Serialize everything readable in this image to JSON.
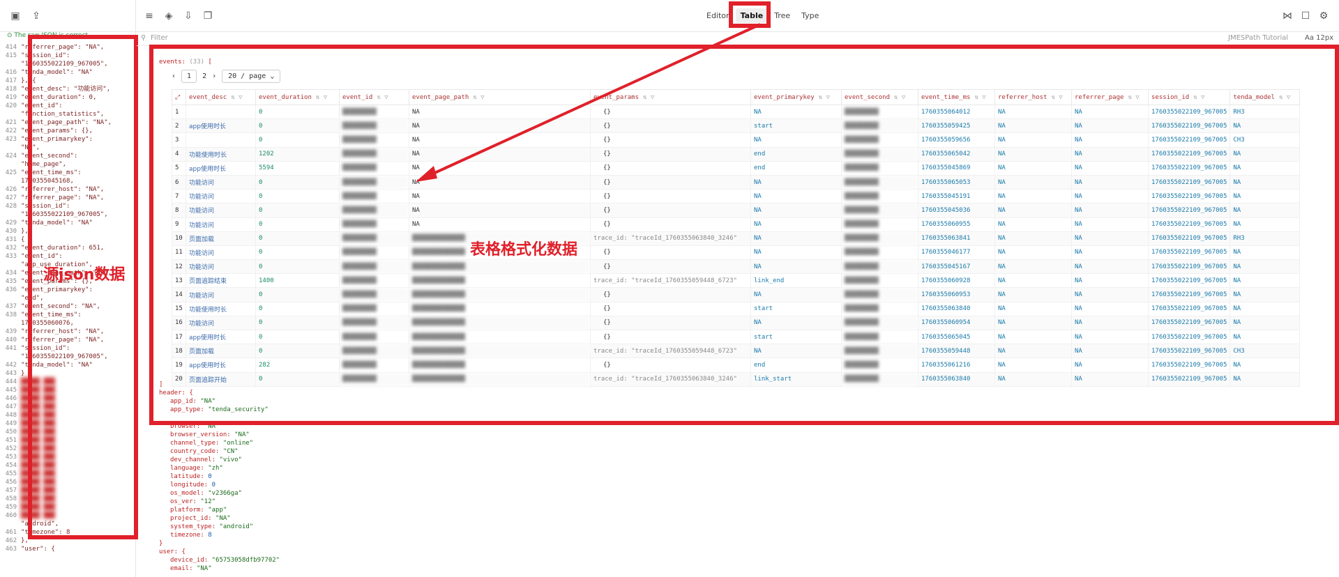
{
  "toolbar": {
    "modes": [
      "Editor",
      "Table",
      "Tree",
      "Type"
    ],
    "active_mode": "Table",
    "left_icons": [
      "package-icon",
      "upload-icon"
    ],
    "mid_icons": [
      "menu-icon",
      "cube-icon",
      "download-icon",
      "copy-icon"
    ],
    "right_icons": [
      "share-icon",
      "comment-icon",
      "gear-icon"
    ],
    "font_size": "12px",
    "jmespath": "JMESPath Tutorial"
  },
  "left": {
    "valid_msg": "The raw JSON is correct.",
    "label": "源json数据",
    "lines": [
      {
        "n": "414",
        "t": "\"referrer_page\": \"NA\","
      },
      {
        "n": "415",
        "t": "\"session_id\":"
      },
      {
        "n": "",
        "t": "\"1760355022109_967005\","
      },
      {
        "n": "416",
        "t": "\"tenda_model\": \"NA\""
      },
      {
        "n": "417",
        "t": "}, {"
      },
      {
        "n": "418",
        "t": "\"event_desc\": \"功能访问\","
      },
      {
        "n": "419",
        "t": "\"event_duration\": 0,"
      },
      {
        "n": "420",
        "t": "\"event_id\":"
      },
      {
        "n": "",
        "t": "\"function_statistics\","
      },
      {
        "n": "421",
        "t": "\"event_page_path\": \"NA\","
      },
      {
        "n": "422",
        "t": "\"event_params\": {},"
      },
      {
        "n": "423",
        "t": "\"event_primarykey\":"
      },
      {
        "n": "",
        "t": "\"NA\","
      },
      {
        "n": "424",
        "t": "\"event_second\":"
      },
      {
        "n": "",
        "t": "\"home_page\","
      },
      {
        "n": "425",
        "t": "\"event_time_ms\":"
      },
      {
        "n": "",
        "t": "1760355045168,"
      },
      {
        "n": "426",
        "t": "\"referrer_host\": \"NA\","
      },
      {
        "n": "427",
        "t": "\"referrer_page\": \"NA\","
      },
      {
        "n": "428",
        "t": "\"session_id\":"
      },
      {
        "n": "",
        "t": "\"1760355022109_967005\","
      },
      {
        "n": "429",
        "t": "\"tenda_model\": \"NA\""
      },
      {
        "n": "430",
        "t": "},"
      },
      {
        "n": "431",
        "t": "{"
      },
      {
        "n": "432",
        "t": "\"event_duration\": 651,"
      },
      {
        "n": "433",
        "t": "\"event_id\":"
      },
      {
        "n": "",
        "t": "\"app_use_duration\","
      },
      {
        "n": "434",
        "t": "\"event_page_path\": \"NA\","
      },
      {
        "n": "435",
        "t": "\"event_params\": {},"
      },
      {
        "n": "436",
        "t": "\"event_primarykey\":"
      },
      {
        "n": "",
        "t": "\"end\","
      },
      {
        "n": "437",
        "t": "\"event_second\": \"NA\","
      },
      {
        "n": "438",
        "t": "\"event_time_ms\":"
      },
      {
        "n": "",
        "t": "1760355060076,"
      },
      {
        "n": "439",
        "t": "\"referrer_host\": \"NA\","
      },
      {
        "n": "440",
        "t": "\"referrer_page\": \"NA\","
      },
      {
        "n": "441",
        "t": "\"session_id\":"
      },
      {
        "n": "",
        "t": "\"1760355022109_967005\","
      },
      {
        "n": "442",
        "t": "\"tenda_model\": \"NA\""
      },
      {
        "n": "443",
        "t": "}"
      }
    ],
    "blur_lines": [
      "444",
      "445",
      "446",
      "447",
      "448",
      "449",
      "450",
      "451",
      "452",
      "453",
      "454",
      "455",
      "456",
      "457",
      "458",
      "459",
      "460"
    ],
    "tail": [
      {
        "n": "",
        "t": "\"android\","
      },
      {
        "n": "461",
        "t": "\"timezone\": 8"
      },
      {
        "n": "462",
        "t": "},"
      },
      {
        "n": "463",
        "t": "\"user\": {"
      }
    ]
  },
  "filter_placeholder": "Filter",
  "table": {
    "header_label": "events:",
    "count": "(33)",
    "pages": [
      "1",
      "2"
    ],
    "page_size": "20 / page",
    "columns": [
      "event_desc",
      "event_duration",
      "event_id",
      "event_page_path",
      "event_params",
      "event_primarykey",
      "event_second",
      "event_time_ms",
      "referrer_host",
      "referrer_page",
      "session_id",
      "tenda_model"
    ],
    "rows": [
      [
        "1",
        "",
        "0",
        "",
        "NA",
        "{}",
        "NA",
        "",
        "1760355064012",
        "NA",
        "NA",
        "1760355022109_967005",
        "RH3"
      ],
      [
        "2",
        "app使用时长",
        "0",
        "",
        "NA",
        "{}",
        "start",
        "",
        "1760355059425",
        "NA",
        "NA",
        "1760355022109_967005",
        "NA"
      ],
      [
        "3",
        "",
        "0",
        "",
        "NA",
        "{}",
        "NA",
        "",
        "1760355059656",
        "NA",
        "NA",
        "1760355022109_967005",
        "CH3"
      ],
      [
        "4",
        "功能使用时长",
        "1202",
        "",
        "NA",
        "{}",
        "end",
        "",
        "1760355065042",
        "NA",
        "NA",
        "1760355022109_967005",
        "NA"
      ],
      [
        "5",
        "app使用时长",
        "5594",
        "",
        "NA",
        "{}",
        "end",
        "",
        "1760355045869",
        "NA",
        "NA",
        "1760355022109_967005",
        "NA"
      ],
      [
        "6",
        "功能访问",
        "0",
        "",
        "NA",
        "{}",
        "NA",
        "",
        "1760355065053",
        "NA",
        "NA",
        "1760355022109_967005",
        "NA"
      ],
      [
        "7",
        "功能访问",
        "0",
        "",
        "NA",
        "{}",
        "NA",
        "",
        "1760355045191",
        "NA",
        "NA",
        "1760355022109_967005",
        "NA"
      ],
      [
        "8",
        "功能访问",
        "0",
        "",
        "NA",
        "{}",
        "NA",
        "",
        "1760355045036",
        "NA",
        "NA",
        "1760355022109_967005",
        "NA"
      ],
      [
        "9",
        "功能访问",
        "0",
        "",
        "NA",
        "{}",
        "NA",
        "",
        "1760355060955",
        "NA",
        "NA",
        "1760355022109_967005",
        "NA"
      ],
      [
        "10",
        "页面加载",
        "0",
        "",
        "",
        "trace_id: \"traceId_1760355063840_3246\"",
        "NA",
        "",
        "1760355063841",
        "NA",
        "NA",
        "1760355022109_967005",
        "RH3"
      ],
      [
        "11",
        "功能访问",
        "0",
        "",
        "",
        "{}",
        "NA",
        "",
        "1760355046177",
        "NA",
        "NA",
        "1760355022109_967005",
        "NA"
      ],
      [
        "12",
        "功能访问",
        "0",
        "",
        "",
        "{}",
        "NA",
        "",
        "1760355045167",
        "NA",
        "NA",
        "1760355022109_967005",
        "NA"
      ],
      [
        "13",
        "页面追踪结束",
        "1400",
        "",
        "",
        "trace_id: \"traceId_1760355059448_6723\"",
        "link_end",
        "",
        "1760355060928",
        "NA",
        "NA",
        "1760355022109_967005",
        "NA"
      ],
      [
        "14",
        "功能访问",
        "0",
        "",
        "",
        "{}",
        "NA",
        "",
        "1760355060953",
        "NA",
        "NA",
        "1760355022109_967005",
        "NA"
      ],
      [
        "15",
        "功能使用时长",
        "0",
        "",
        "",
        "{}",
        "start",
        "",
        "1760355063840",
        "NA",
        "NA",
        "1760355022109_967005",
        "NA"
      ],
      [
        "16",
        "功能访问",
        "0",
        "",
        "",
        "{}",
        "NA",
        "",
        "1760355060954",
        "NA",
        "NA",
        "1760355022109_967005",
        "NA"
      ],
      [
        "17",
        "app使用时长",
        "0",
        "",
        "",
        "{}",
        "start",
        "",
        "1760355065045",
        "NA",
        "NA",
        "1760355022109_967005",
        "NA"
      ],
      [
        "18",
        "页面加载",
        "0",
        "",
        "",
        "trace_id: \"traceId_1760355059448_6723\"",
        "NA",
        "",
        "1760355059448",
        "NA",
        "NA",
        "1760355022109_967005",
        "CH3"
      ],
      [
        "19",
        "app使用时长",
        "282",
        "",
        "",
        "{}",
        "end",
        "",
        "1760355061216",
        "NA",
        "NA",
        "1760355022109_967005",
        "NA"
      ],
      [
        "20",
        "页面追踪开始",
        "0",
        "",
        "",
        "trace_id: \"traceId_1760355063840_3246\"",
        "link_start",
        "",
        "1760355063840",
        "NA",
        "NA",
        "1760355022109_967005",
        "NA"
      ]
    ],
    "label": "表格格式化数据"
  },
  "json_rest": [
    {
      "ind": 0,
      "k": "]",
      "v": ""
    },
    {
      "ind": 0,
      "k": "header: {",
      "v": ""
    },
    {
      "ind": 1,
      "k": "app_id: ",
      "v": "\"NA\""
    },
    {
      "ind": 1,
      "k": "app_type: ",
      "v": "\"tenda_security\""
    },
    {
      "ind": 1,
      "k": "",
      "v": ""
    },
    {
      "ind": 1,
      "k": "browser: ",
      "v": "\"NA\""
    },
    {
      "ind": 1,
      "k": "browser_version: ",
      "v": "\"NA\""
    },
    {
      "ind": 1,
      "k": "channel_type: ",
      "v": "\"online\""
    },
    {
      "ind": 1,
      "k": "country_code: ",
      "v": "\"CN\""
    },
    {
      "ind": 1,
      "k": "dev_channel: ",
      "v": "\"vivo\""
    },
    {
      "ind": 1,
      "k": "language: ",
      "v": "\"zh\""
    },
    {
      "ind": 1,
      "k": "latitude: ",
      "v": "0"
    },
    {
      "ind": 1,
      "k": "longitude: ",
      "v": "0"
    },
    {
      "ind": 1,
      "k": "os_model: ",
      "v": "\"v2366ga\""
    },
    {
      "ind": 1,
      "k": "os_ver: ",
      "v": "\"12\""
    },
    {
      "ind": 1,
      "k": "platform: ",
      "v": "\"app\""
    },
    {
      "ind": 1,
      "k": "project_id: ",
      "v": "\"NA\""
    },
    {
      "ind": 1,
      "k": "system_type: ",
      "v": "\"android\""
    },
    {
      "ind": 1,
      "k": "timezone: ",
      "v": "8"
    },
    {
      "ind": 0,
      "k": "}",
      "v": ""
    },
    {
      "ind": 0,
      "k": "user: {",
      "v": ""
    },
    {
      "ind": 1,
      "k": "device_id: ",
      "v": "\"65753058dfb97702\""
    },
    {
      "ind": 1,
      "k": "email: ",
      "v": "\"NA\""
    }
  ]
}
